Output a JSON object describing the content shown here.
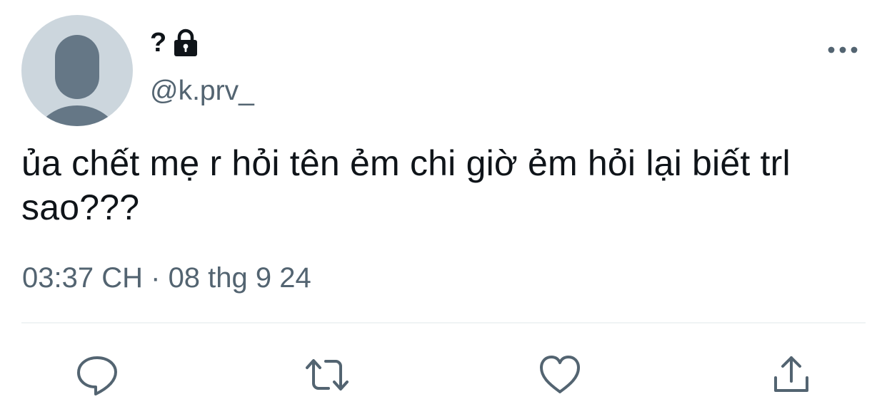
{
  "user": {
    "display_name": "?",
    "handle": "@k.prv_",
    "avatar_icon": "default-avatar-icon",
    "protected_icon": "lock-icon"
  },
  "tweet": {
    "text": "ủa chết mẹ r hỏi tên ẻm chi giờ ẻm hỏi lại biết trl sao???",
    "time": "03:37 CH",
    "separator": "·",
    "date": "08 thg 9 24"
  },
  "actions": [
    "reply-icon",
    "retweet-icon",
    "like-icon",
    "share-icon"
  ],
  "menu_icon": "more-icon",
  "colors": {
    "text_primary": "#0f1419",
    "text_secondary": "#536471",
    "avatar_bg": "#ccd6dd",
    "avatar_fg": "#657786",
    "divider": "#eff3f4"
  }
}
